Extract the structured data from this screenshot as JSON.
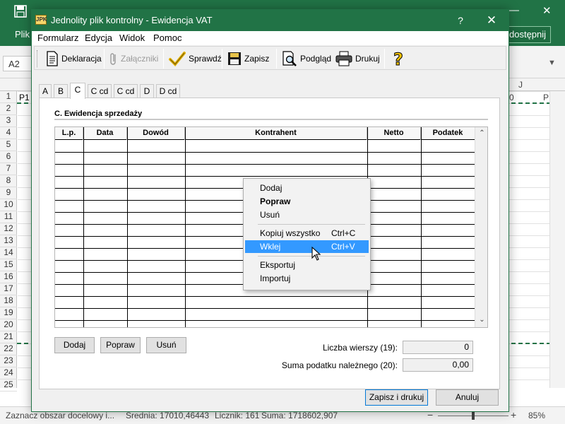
{
  "excel": {
    "file_tab": "Plik",
    "share_label": "dostępnij",
    "name_box": "A2",
    "col_letters": [
      "J",
      "0",
      "P"
    ],
    "cell_p1": "P1",
    "row_numbers": [
      "1",
      "2",
      "3",
      "4",
      "5",
      "6",
      "7",
      "8",
      "9",
      "10",
      "11",
      "12",
      "13",
      "14",
      "15",
      "16",
      "17",
      "18",
      "19",
      "20",
      "21",
      "22",
      "23",
      "24",
      "25"
    ],
    "status_left": "Zaznacz obszar docelowy i...",
    "status_avg": "Średnia: 17010,46443",
    "status_count": "Licznik: 161",
    "status_sum": "Suma: 1718602,907",
    "zoom": "85%",
    "accent_color": "#217346"
  },
  "dialog": {
    "icon_text": "JPK",
    "title": "Jednolity plik kontrolny - Ewidencja VAT",
    "help_button": "?",
    "close_button": "✕",
    "menu": [
      "Formularz",
      "Edycja",
      "Widok",
      "Pomoc"
    ],
    "toolbar": {
      "deklaracja": "Deklaracja",
      "zalaczniki": "Załączniki",
      "sprawdz": "Sprawdź",
      "zapisz": "Zapisz",
      "podglad": "Podgląd",
      "drukuj": "Drukuj"
    },
    "tabs": [
      "A",
      "B",
      "C",
      "C cd",
      "C cd",
      "D",
      "D cd"
    ],
    "active_tab": "C",
    "section_title": "C. Ewidencja sprzedaży",
    "table": {
      "columns": [
        "L.p.",
        "Data",
        "Dowód",
        "Kontrahent",
        "Netto",
        "Podatek"
      ],
      "rows": 15
    },
    "buttons": {
      "dodaj": "Dodaj",
      "popraw": "Popraw",
      "usun": "Usuń",
      "zapisz_drukuj": "Zapisz i drukuj",
      "anuluj": "Anuluj"
    },
    "fields": {
      "liczba_wierszy_label": "Liczba wierszy (19):",
      "liczba_wierszy_value": "0",
      "suma_podatku_label": "Suma podatku należnego (20):",
      "suma_podatku_value": "0,00"
    }
  },
  "context_menu": {
    "items": [
      {
        "label": "Dodaj",
        "shortcut": ""
      },
      {
        "label": "Popraw",
        "shortcut": "",
        "bold": true
      },
      {
        "label": "Usuń",
        "shortcut": ""
      },
      {
        "label": "Kopiuj wszystko",
        "shortcut": "Ctrl+C"
      },
      {
        "label": "Wklej",
        "shortcut": "Ctrl+V",
        "highlighted": true
      },
      {
        "label": "Eksportuj",
        "shortcut": ""
      },
      {
        "label": "Importuj",
        "shortcut": ""
      }
    ],
    "highlight_color": "#3399ff"
  }
}
